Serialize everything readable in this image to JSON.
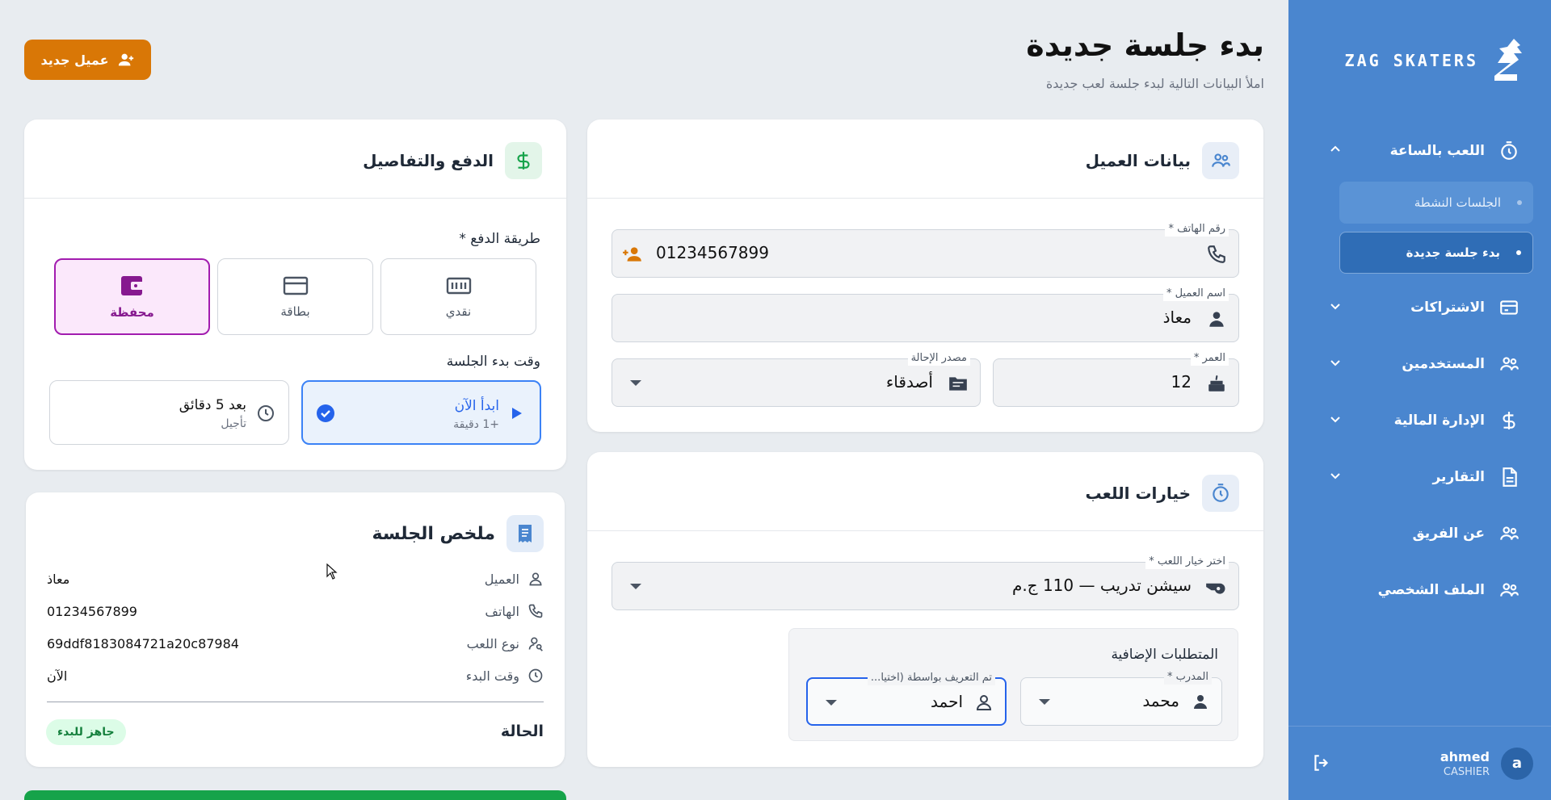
{
  "sidebar": {
    "brand": "ZAG SKATERS",
    "items": [
      {
        "label": "اللعب بالساعة",
        "icon": "timer-icon"
      },
      {
        "label": "الاشتراكات",
        "icon": "card-icon"
      },
      {
        "label": "المستخدمين",
        "icon": "users-icon"
      },
      {
        "label": "الإدارة المالية",
        "icon": "dollar-icon"
      },
      {
        "label": "التقارير",
        "icon": "document-icon"
      },
      {
        "label": "عن الفريق",
        "icon": "users-icon"
      },
      {
        "label": "الملف الشخصي",
        "icon": "users-icon"
      }
    ],
    "subitems": [
      {
        "label": "الجلسات النشطة"
      },
      {
        "label": "بدء جلسة جديدة"
      }
    ],
    "user": {
      "initial": "a",
      "name": "ahmed",
      "role": "CASHIER"
    }
  },
  "header": {
    "title": "بدء جلسة جديدة",
    "subtitle": "املأ البيانات التالية لبدء جلسة لعب جديدة",
    "new_client_label": "عميل جديد"
  },
  "client": {
    "title": "بيانات العميل",
    "phone_label": "رقم الهاتف *",
    "phone_value": "01234567899",
    "name_label": "اسم العميل *",
    "name_value": "معاذ",
    "age_label": "العمر *",
    "age_value": "12",
    "referral_label": "مصدر الإحالة",
    "referral_value": "أصدقاء"
  },
  "game": {
    "title": "خيارات اللعب",
    "option_label": "اختر خيار اللعب *",
    "option_value": "سيشن تدريب — 110 ج.م",
    "extras_title": "المتطلبات الإضافية",
    "coach_label": "المدرب *",
    "coach_value": "محمد",
    "identified_label": "تم التعريف بواسطة (اختيا...",
    "identified_value": "احمد"
  },
  "payment": {
    "title": "الدفع والتفاصيل",
    "method_label": "طريقة الدفع *",
    "methods": [
      {
        "label": "نقدي",
        "icon": "cash-icon"
      },
      {
        "label": "بطاقة",
        "icon": "card-icon"
      },
      {
        "label": "محفظة",
        "icon": "wallet-icon"
      }
    ],
    "selected_method": "محفظة",
    "start_label": "وقت بدء الجلسة",
    "start_now_title": "ابدأ الآن",
    "start_now_sub": "+1 دقيقة",
    "start_later_title": "بعد 5 دقائق",
    "start_later_sub": "تأجيل"
  },
  "summary": {
    "title": "ملخص الجلسة",
    "rows": [
      {
        "key": "العميل",
        "value": "معاذ"
      },
      {
        "key": "الهاتف",
        "value": "01234567899"
      },
      {
        "key": "نوع اللعب",
        "value": "69ddf8183084721a20c87984"
      },
      {
        "key": "وقت البدء",
        "value": "الآن"
      }
    ],
    "status_label": "الحالة",
    "status_value": "جاهز للبدء"
  },
  "colors": {
    "sidebar": "#4a86cf",
    "accent_orange": "#d97706",
    "selected_purple": "#a21caf",
    "primary_blue": "#2563eb",
    "success_green": "#15803d"
  }
}
